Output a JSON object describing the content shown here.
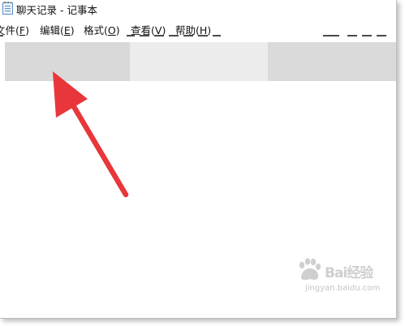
{
  "window": {
    "title": "聊天记录 - 记事本"
  },
  "menu": {
    "file": {
      "label": "文件(",
      "key": "F",
      "close": ")"
    },
    "edit": {
      "label": "编辑(",
      "key": "E",
      "close": ")"
    },
    "format": {
      "label": "格式(",
      "key": "O",
      "close": ")"
    },
    "view": {
      "label": "查看(",
      "key": "V",
      "close": ")"
    },
    "help": {
      "label": "帮助(",
      "key": "H",
      "close": ")"
    }
  },
  "watermark": {
    "brand": "Bai经验",
    "site": "jingyan.baidu.com"
  },
  "colors": {
    "arrow": "#e8363a",
    "redaction_dark": "#d9d9d9",
    "redaction_light": "#ececec"
  }
}
